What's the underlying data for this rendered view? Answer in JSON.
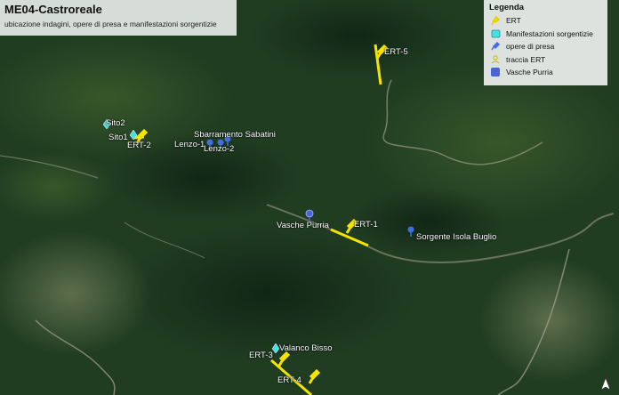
{
  "title": "ME04-Castroreale",
  "subtitle": "ubicazione indagini, opere di presa e manifestazioni sorgentizie",
  "legend": {
    "title": "Legenda",
    "items": [
      {
        "label": "ERT",
        "icon": "yellow-pin-icon"
      },
      {
        "label": "Manifestazioni sorgentizie",
        "icon": "cyan-square-icon"
      },
      {
        "label": "opere di presa",
        "icon": "blue-pin-icon"
      },
      {
        "label": "traccia ERT",
        "icon": "ert-track-icon"
      },
      {
        "label": "Vasche Purria",
        "icon": "blue-circle-icon"
      }
    ]
  },
  "labels": {
    "ert5": "ERT-5",
    "sito2": "Sito2",
    "sito1": "Sito1",
    "ert2": "ERT-2",
    "sbarramento": "Sbarramento Sabatini",
    "lenzo1": "Lenzo-1",
    "lenzo2": "Lenzo-2",
    "vasche": "Vasche Purria",
    "ert1": "ERT-1",
    "sorgente": "Sorgente Isola Buglio",
    "valanco": "Valanco Bisso",
    "ert3": "ERT-3",
    "ert4": "ERT-4"
  },
  "colors": {
    "ert": "#f5e400",
    "spring": "#45e0e8",
    "intake": "#3f6fe0",
    "vasche": "#4a63d8",
    "forest": "#1f3d1f"
  }
}
